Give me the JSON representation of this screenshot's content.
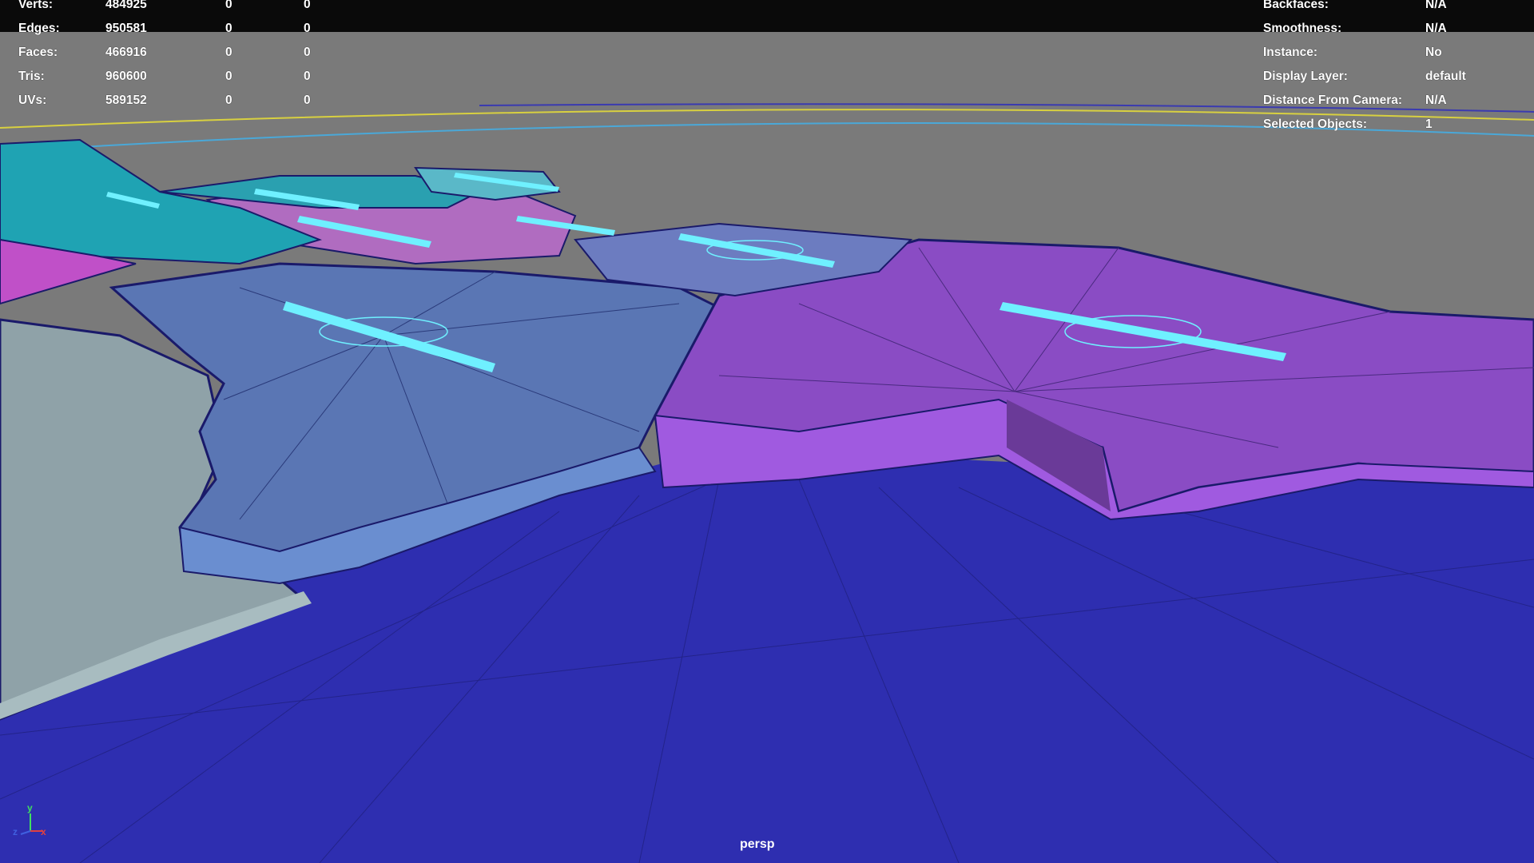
{
  "viewport": {
    "camera_name": "persp",
    "colors": {
      "background": "#7a7a7a",
      "ground": "#2e2eb0",
      "region_purple": "#8a4cc4",
      "region_slate": "#5a76b4",
      "region_teal": "#1fa3b3",
      "region_pink": "#c050c8",
      "region_grey": "#8fa2a8",
      "label_text": "#6ff0ff"
    }
  },
  "hud_left": {
    "rows": [
      {
        "label": "Verts:",
        "v1": "484925",
        "v2": "0",
        "v3": "0"
      },
      {
        "label": "Edges:",
        "v1": "950581",
        "v2": "0",
        "v3": "0"
      },
      {
        "label": "Faces:",
        "v1": "466916",
        "v2": "0",
        "v3": "0"
      },
      {
        "label": "Tris:",
        "v1": "960600",
        "v2": "0",
        "v3": "0"
      },
      {
        "label": "UVs:",
        "v1": "589152",
        "v2": "0",
        "v3": "0"
      }
    ]
  },
  "hud_right": {
    "rows": [
      {
        "label": "Backfaces:",
        "value": "N/A"
      },
      {
        "label": "Smoothness:",
        "value": "N/A"
      },
      {
        "label": "Instance:",
        "value": "No"
      },
      {
        "label": "Display Layer:",
        "value": "default"
      },
      {
        "label": "Distance From Camera:",
        "value": "N/A"
      },
      {
        "label": "Selected Objects:",
        "value": "1"
      }
    ]
  },
  "axis": {
    "x": "x",
    "y": "y",
    "z": "z"
  }
}
